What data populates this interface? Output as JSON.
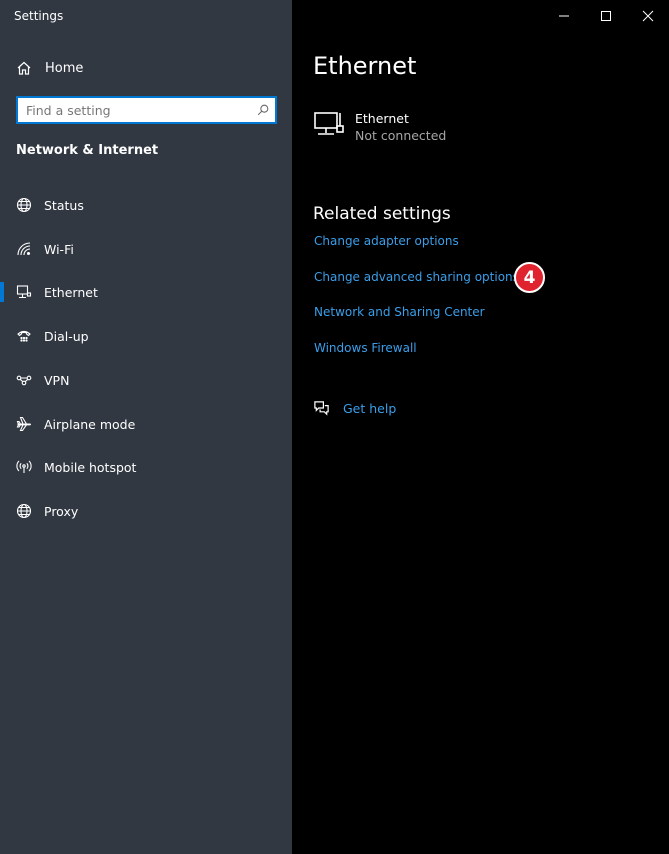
{
  "window": {
    "app_title": "Settings",
    "accent_color": "#0078d4",
    "link_color": "#3b9ee9"
  },
  "sidebar": {
    "home_label": "Home",
    "search_placeholder": "Find a setting",
    "section_title": "Network & Internet",
    "items": [
      {
        "label": "Status",
        "icon": "globe-status-icon"
      },
      {
        "label": "Wi-Fi",
        "icon": "wifi-icon"
      },
      {
        "label": "Ethernet",
        "icon": "ethernet-icon",
        "selected": true
      },
      {
        "label": "Dial-up",
        "icon": "dial-up-icon"
      },
      {
        "label": "VPN",
        "icon": "vpn-icon"
      },
      {
        "label": "Airplane mode",
        "icon": "airplane-icon"
      },
      {
        "label": "Mobile hotspot",
        "icon": "hotspot-icon"
      },
      {
        "label": "Proxy",
        "icon": "globe-icon"
      }
    ]
  },
  "main": {
    "title": "Ethernet",
    "ethernet_name": "Ethernet",
    "ethernet_status": "Not connected",
    "related_title": "Related settings",
    "links": [
      "Change adapter options",
      "Change advanced sharing options",
      "Network and Sharing Center",
      "Windows Firewall"
    ],
    "step_badge": "4",
    "get_help": "Get help"
  }
}
